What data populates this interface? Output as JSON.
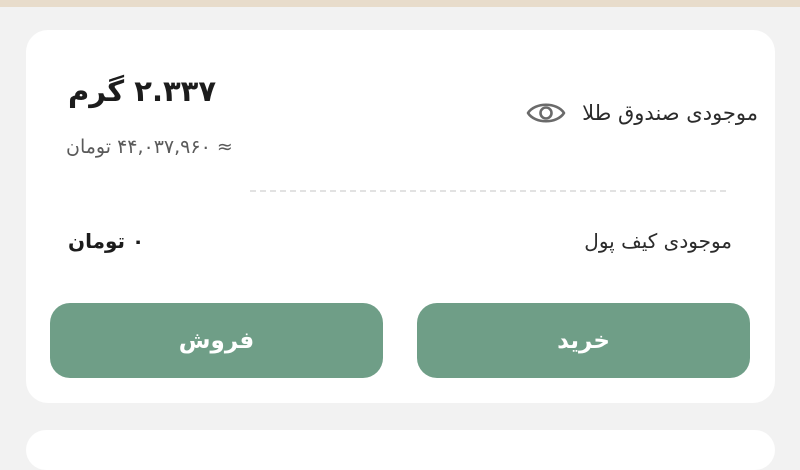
{
  "gold_fund": {
    "label": "موجودی صندوق طلا",
    "amount": "۲.۳۳۷ گرم",
    "value": "≈ ۴۴,۰۳۷,۹۶۰ تومان"
  },
  "wallet": {
    "label": "موجودی کیف پول",
    "value": "۰ تومان"
  },
  "actions": {
    "sell_label": "فروش",
    "buy_label": "خرید"
  },
  "colors": {
    "button": "#6f9e87",
    "background": "#f2f2f2",
    "card": "#ffffff"
  },
  "icons": {
    "visibility": "eye-icon"
  }
}
